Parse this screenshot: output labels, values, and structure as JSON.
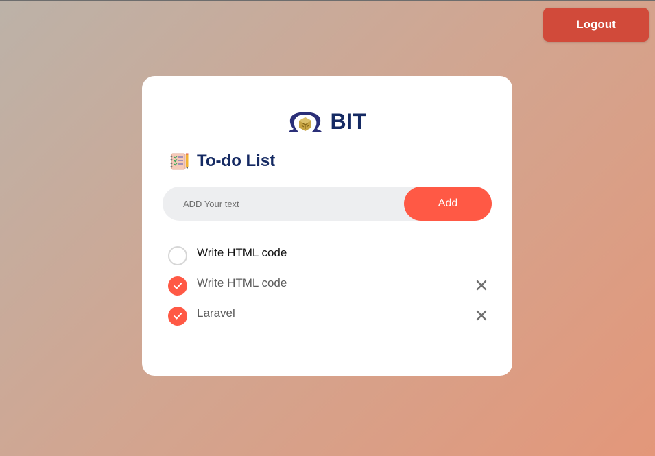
{
  "header": {
    "logout_label": "Logout"
  },
  "brand": {
    "name": "BIT",
    "logo_icon": "bit-logo-icon"
  },
  "todo": {
    "heading": "To-do List",
    "heading_icon": "checklist-notepad-icon",
    "input_placeholder": "ADD Your text",
    "input_value": "",
    "add_label": "Add",
    "tasks": [
      {
        "text": "Write HTML code",
        "done": false
      },
      {
        "text": "Write HTML code",
        "done": true
      },
      {
        "text": "Laravel",
        "done": true
      }
    ]
  },
  "colors": {
    "accent": "#ff5945",
    "logout": "#d14a3a",
    "heading": "#152a63"
  }
}
